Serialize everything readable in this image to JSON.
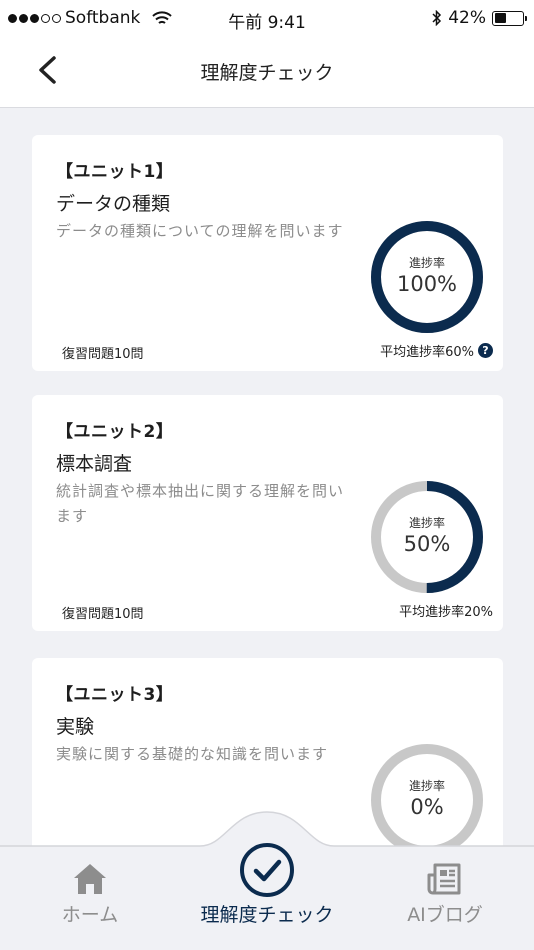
{
  "status_bar": {
    "carrier": "Softbank",
    "time": "午前 9:41",
    "battery": "42%",
    "battery_level": 0.42
  },
  "nav": {
    "title": "理解度チェック"
  },
  "units": [
    {
      "label": "【ユニット1】",
      "title": "データの種類",
      "description": "データの種類についての理解を問います",
      "review": "復習問題10問",
      "average": "平均進捗率60%",
      "progress_label": "進捗率",
      "progress_text": "100%",
      "progress": 1.0,
      "show_help": true
    },
    {
      "label": "【ユニット2】",
      "title": "標本調査",
      "description": "統計調査や標本抽出に関する理解を問います",
      "review": "復習問題10問",
      "average": "平均進捗率20%",
      "progress_label": "進捗率",
      "progress_text": "50%",
      "progress": 0.5,
      "show_help": false
    },
    {
      "label": "【ユニット3】",
      "title": "実験",
      "description": "実験に関する基礎的な知識を問います",
      "review": "",
      "average": "",
      "progress_label": "進捗率",
      "progress_text": "0%",
      "progress": 0.0,
      "show_help": false
    }
  ],
  "tabs": [
    {
      "label": "ホーム",
      "icon": "home-icon",
      "active": false
    },
    {
      "label": "理解度チェック",
      "icon": "check-circle-icon",
      "active": true
    },
    {
      "label": "AIブログ",
      "icon": "newspaper-icon",
      "active": false
    }
  ],
  "colors": {
    "accent": "#0b2b4e",
    "ring_track": "#c8c8c8",
    "inactive_tab": "#8d8d8d",
    "background": "#f0f1f5"
  }
}
